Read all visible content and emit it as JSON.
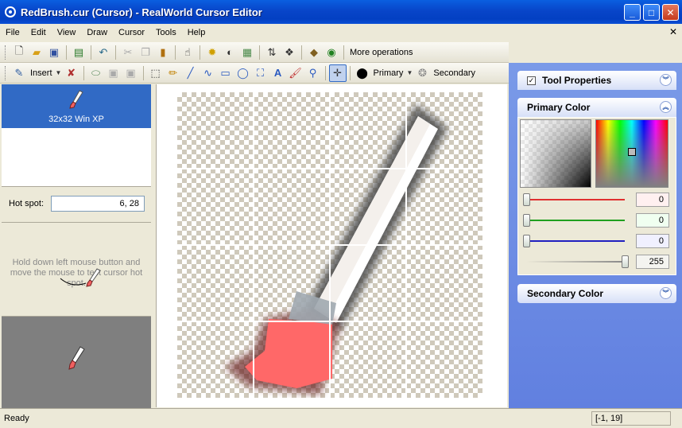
{
  "window": {
    "title": "RedBrush.cur (Cursor) - RealWorld Cursor Editor",
    "min": "_",
    "max": "□",
    "close": "✕"
  },
  "menu": [
    "File",
    "Edit",
    "View",
    "Draw",
    "Cursor",
    "Tools",
    "Help"
  ],
  "mdi_close": "✕",
  "toolbar1": {
    "more_label": "More operations"
  },
  "toolbar2": {
    "insert_label": "Insert",
    "primary_label": "Primary",
    "secondary_label": "Secondary"
  },
  "frames": {
    "selected_label": "32x32 Win XP"
  },
  "hotspot": {
    "label": "Hot spot:",
    "value": "6, 28"
  },
  "test_hint": "Hold down left mouse button and move the mouse to test cursor hot spot.",
  "panels": {
    "tool_properties": "Tool Properties",
    "primary_color": "Primary Color",
    "secondary_color": "Secondary Color"
  },
  "color": {
    "red": 0,
    "green": 0,
    "blue": 0,
    "alpha": 255,
    "red_text": "0",
    "green_text": "0",
    "blue_text": "0",
    "alpha_text": "255",
    "accent_red": "#e03030",
    "accent_green": "#20a020",
    "accent_blue": "#2020c0"
  },
  "status": {
    "text": "Ready",
    "coords": "[-1, 19]"
  },
  "icons": {
    "brush": "brush-icon",
    "insert": "insert-icon"
  }
}
